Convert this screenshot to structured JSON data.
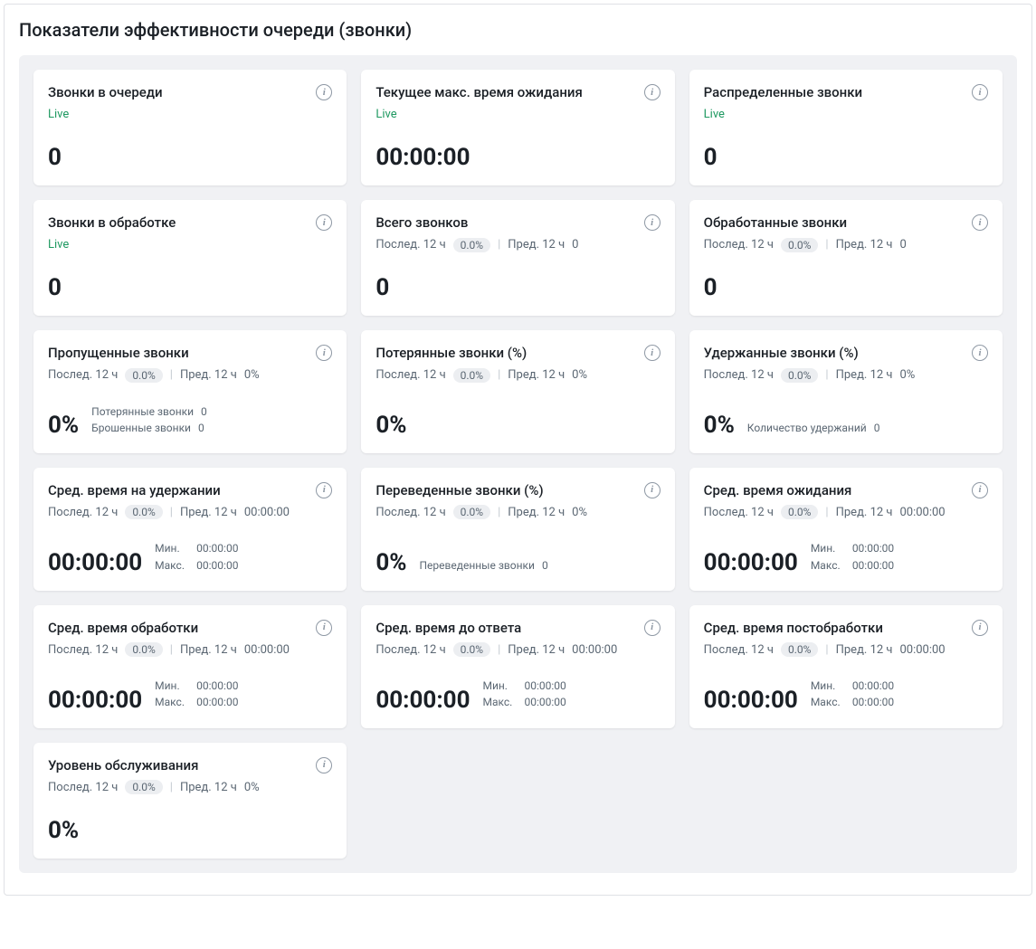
{
  "page": {
    "title": "Показатели эффективности очереди (звонки)"
  },
  "labels": {
    "live": "Live",
    "last12h": "Послед. 12 ч",
    "prev12h": "Пред. 12 ч",
    "min": "Мин.",
    "max": "Макс.",
    "sep": "|"
  },
  "cards": [
    {
      "id": "calls-in-queue",
      "title": "Звонки в очереди",
      "mode": "live",
      "value": "0"
    },
    {
      "id": "current-max-wait",
      "title": "Текущее макс. время ожидания",
      "mode": "live",
      "value": "00:00:00"
    },
    {
      "id": "distributed-calls",
      "title": "Распределенные звонки",
      "mode": "live",
      "value": "0"
    },
    {
      "id": "calls-in-progress",
      "title": "Звонки в обработке",
      "mode": "live",
      "value": "0"
    },
    {
      "id": "total-calls",
      "title": "Всего звонков",
      "mode": "stats",
      "pill": "0.0%",
      "prev": "0",
      "value": "0"
    },
    {
      "id": "handled-calls",
      "title": "Обработанные звонки",
      "mode": "stats",
      "pill": "0.0%",
      "prev": "0",
      "value": "0"
    },
    {
      "id": "missed-calls",
      "title": "Пропущенные звонки",
      "mode": "stats",
      "pill": "0.0%",
      "prev": "0%",
      "value": "0%",
      "details": [
        {
          "label": "Потерянные звонки",
          "value": "0"
        },
        {
          "label": "Брошенные звонки",
          "value": "0"
        }
      ]
    },
    {
      "id": "lost-calls-pct",
      "title": "Потерянные звонки (%)",
      "mode": "stats",
      "pill": "0.0%",
      "prev": "0%",
      "value": "0%"
    },
    {
      "id": "held-calls-pct",
      "title": "Удержанные звонки (%)",
      "mode": "stats",
      "pill": "0.0%",
      "prev": "0%",
      "value": "0%",
      "details": [
        {
          "label": "Количество удержаний",
          "value": "0"
        }
      ]
    },
    {
      "id": "avg-hold-time",
      "title": "Сред. время на удержании",
      "mode": "stats",
      "pill": "0.0%",
      "prev": "00:00:00",
      "value": "00:00:00",
      "minmax": {
        "min": "00:00:00",
        "max": "00:00:00"
      }
    },
    {
      "id": "transferred-calls-pct",
      "title": "Переведенные звонки (%)",
      "mode": "stats",
      "pill": "0.0%",
      "prev": "0%",
      "value": "0%",
      "details": [
        {
          "label": "Переведенные звонки",
          "value": "0"
        }
      ]
    },
    {
      "id": "avg-wait-time",
      "title": "Сред. время ожидания",
      "mode": "stats",
      "pill": "0.0%",
      "prev": "00:00:00",
      "value": "00:00:00",
      "minmax": {
        "min": "00:00:00",
        "max": "00:00:00"
      }
    },
    {
      "id": "avg-handle-time",
      "title": "Сред. время обработки",
      "mode": "stats",
      "pill": "0.0%",
      "prev": "00:00:00",
      "value": "00:00:00",
      "minmax": {
        "min": "00:00:00",
        "max": "00:00:00"
      }
    },
    {
      "id": "avg-answer-time",
      "title": "Сред. время до ответа",
      "mode": "stats",
      "pill": "0.0%",
      "prev": "00:00:00",
      "value": "00:00:00",
      "minmax": {
        "min": "00:00:00",
        "max": "00:00:00"
      }
    },
    {
      "id": "avg-acw-time",
      "title": "Сред. время постобработки",
      "mode": "stats",
      "pill": "0.0%",
      "prev": "00:00:00",
      "value": "00:00:00",
      "minmax": {
        "min": "00:00:00",
        "max": "00:00:00"
      }
    },
    {
      "id": "service-level",
      "title": "Уровень обслуживания",
      "mode": "stats",
      "pill": "0.0%",
      "prev": "0%",
      "value": "0%"
    }
  ]
}
